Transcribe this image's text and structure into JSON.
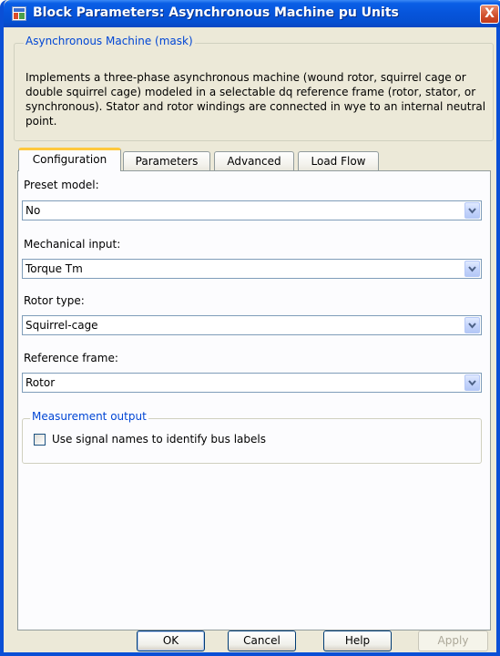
{
  "window": {
    "title": "Block Parameters: Asynchronous Machine pu Units",
    "close_glyph": "X"
  },
  "mask": {
    "legend": "Asynchronous Machine (mask)",
    "description": "Implements a three-phase asynchronous machine (wound rotor, squirrel cage or double squirrel cage) modeled in a selectable dq reference frame (rotor, stator, or synchronous). Stator and rotor windings are connected in wye to an internal neutral point."
  },
  "tabs": [
    {
      "label": "Configuration",
      "active": true
    },
    {
      "label": "Parameters",
      "active": false
    },
    {
      "label": "Advanced",
      "active": false
    },
    {
      "label": "Load Flow",
      "active": false
    }
  ],
  "fields": {
    "preset_model": {
      "label": "Preset model:",
      "value": "No"
    },
    "mechanical_input": {
      "label": "Mechanical input:",
      "value": "Torque Tm"
    },
    "rotor_type": {
      "label": "Rotor type:",
      "value": "Squirrel-cage"
    },
    "reference_frame": {
      "label": "Reference frame:",
      "value": "Rotor"
    }
  },
  "measurement": {
    "legend": "Measurement output",
    "checkbox_label": "Use signal names to identify bus labels",
    "checked": false
  },
  "buttons": {
    "ok": "OK",
    "cancel": "Cancel",
    "help": "Help",
    "apply": "Apply"
  },
  "colors": {
    "titlebar": "#0654da",
    "accent_text": "#0046d5",
    "tab_highlight": "#ffc83c"
  }
}
